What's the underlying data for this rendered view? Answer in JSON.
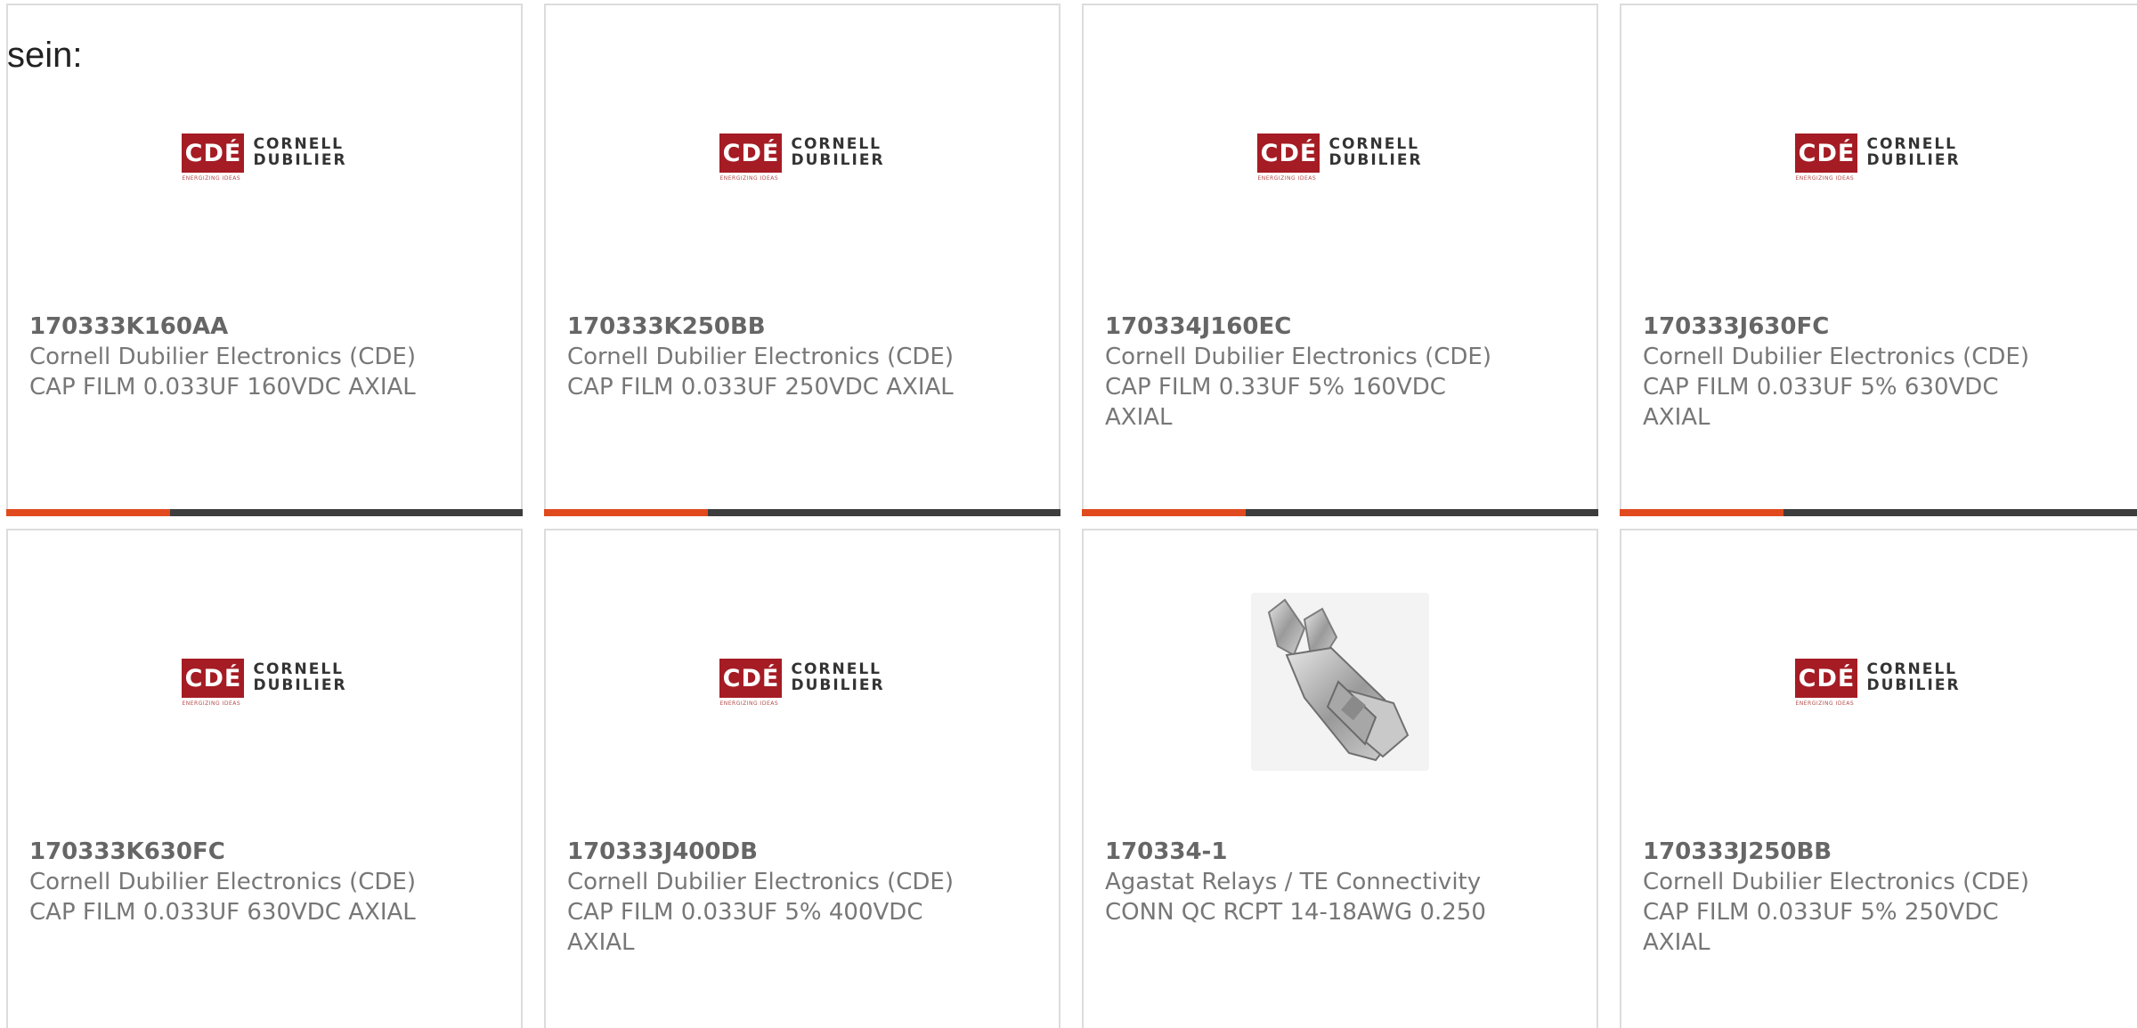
{
  "heading": "sein:",
  "logo": {
    "mark_text": "CDÉ",
    "line1": "CORNELL",
    "line2": "DUBILIER",
    "tagline": "ENERGIZING IDEAS"
  },
  "colors": {
    "accent": "#e04a1e",
    "bar": "#3d3d3d",
    "logo_red": "#a51c24"
  },
  "products": [
    {
      "part_number": "170333K160AA",
      "manufacturer": "Cornell Dubilier Electronics (CDE)",
      "description": "CAP FILM 0.033UF 160VDC AXIAL",
      "image": "cde-logo"
    },
    {
      "part_number": "170333K250BB",
      "manufacturer": "Cornell Dubilier Electronics (CDE)",
      "description": "CAP FILM 0.033UF 250VDC AXIAL",
      "image": "cde-logo"
    },
    {
      "part_number": "170334J160EC",
      "manufacturer": "Cornell Dubilier Electronics (CDE)",
      "description": "CAP FILM 0.33UF 5% 160VDC AXIAL",
      "image": "cde-logo"
    },
    {
      "part_number": "170333J630FC",
      "manufacturer": "Cornell Dubilier Electronics (CDE)",
      "description": "CAP FILM 0.033UF 5% 630VDC AXIAL",
      "image": "cde-logo"
    },
    {
      "part_number": "170333K630FC",
      "manufacturer": "Cornell Dubilier Electronics (CDE)",
      "description": "CAP FILM 0.033UF 630VDC AXIAL",
      "image": "cde-logo"
    },
    {
      "part_number": "170333J400DB",
      "manufacturer": "Cornell Dubilier Electronics (CDE)",
      "description": "CAP FILM 0.033UF 5% 400VDC AXIAL",
      "image": "cde-logo"
    },
    {
      "part_number": "170334-1",
      "manufacturer": "Agastat Relays / TE Connectivity",
      "description": "CONN QC RCPT 14-18AWG 0.250",
      "image": "terminal-photo"
    },
    {
      "part_number": "170333J250BB",
      "manufacturer": "Cornell Dubilier Electronics (CDE)",
      "description": "CAP FILM 0.033UF 5% 250VDC AXIAL",
      "image": "cde-logo"
    }
  ]
}
